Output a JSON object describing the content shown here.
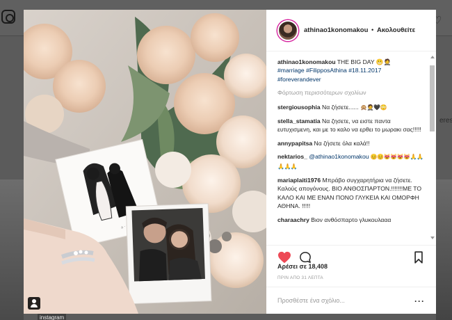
{
  "background": {
    "refresh_text": "eresh",
    "instagram_label": "instagram"
  },
  "post": {
    "username": "athinao1konomakou",
    "separator": "•",
    "follow_label": "Ακολουθείτε",
    "caption_text": "THE BIG DAY 😬🤵",
    "caption_tags": "#marriage #FilipposAthina #18.11.2017",
    "caption_tags2": "#foreverandever",
    "load_more": "Φόρτωση περισσότερων σχολίων",
    "comments": [
      {
        "user": "stergiousophia",
        "text": "Να ζήσετε...... ",
        "emoji": "🙊🤵🖤😳"
      },
      {
        "user": "stella_stamatia",
        "text": "Να ζησετε, να ειστε παντα ευτυχισμενη, και με το καλο να ερθει το μωρακι σας!!!!!"
      },
      {
        "user": "annypapitsa",
        "text": "Να ζήσετε όλα καλά!!"
      },
      {
        "user": "nektarios_",
        "mention": "@athinao1konomakou",
        "emoji": "😊😊😻😻😻😻🙏🙏🙏🙏🙏"
      },
      {
        "user": "mariaplaiti1976",
        "text": "Μπράβο συγχαρητήρια να ζήσετε. Καλούς απογόνους. ΒΙΟ ΑΝΘΟΣΠΑΡΤΟΝ.!!!!!!!ΜΕ ΤΟ ΚΑΛΟ ΚΑΙ ΜΕ ΕΝΑΝ ΠΟΝΟ ΓΛΥΚΕΙΑ ΚΑΙ ΟΜΟΡΦΗ ΑΘΗΝΑ. !!!!!"
      },
      {
        "user": "charaachry",
        "text": "Βιον ανθόσπαρτο γλυκουλααα"
      }
    ],
    "likes": "Αρέσει σε 18,408",
    "timestamp": "ΠΡΙΝ ΑΠΟ 31 ΛΕΠΤΑ",
    "add_comment_placeholder": "Προσθέστε ένα σχόλιο...",
    "more_label": "···"
  },
  "colors": {
    "like_red": "#ed4956",
    "link_blue": "#003569"
  },
  "icons": [
    "heart-icon",
    "comment-icon",
    "bookmark-icon",
    "user-tag-icon",
    "more-options-icon"
  ]
}
